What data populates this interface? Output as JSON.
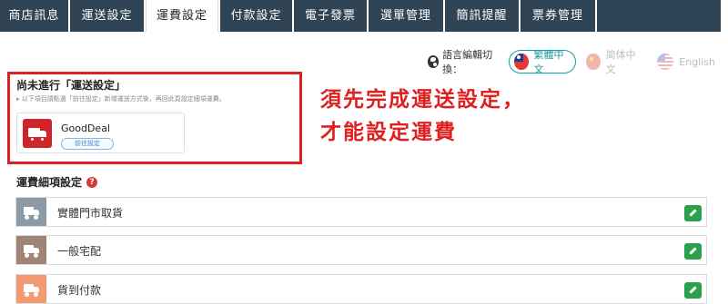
{
  "tabs": [
    {
      "label": "商店訊息",
      "active": false
    },
    {
      "label": "運送設定",
      "active": false
    },
    {
      "label": "運費設定",
      "active": true
    },
    {
      "label": "付款設定",
      "active": false
    },
    {
      "label": "電子發票",
      "active": false
    },
    {
      "label": "選單管理",
      "active": false
    },
    {
      "label": "簡訊提醒",
      "active": false
    },
    {
      "label": "票券管理",
      "active": false
    }
  ],
  "language": {
    "label": "語言編輯切換：",
    "options": [
      {
        "label": "繁體中文",
        "icon": "taiwan-flag-icon",
        "active": true
      },
      {
        "label": "简体中文",
        "icon": "china-flag-icon",
        "active": false
      },
      {
        "label": "English",
        "icon": "us-flag-icon",
        "active": false
      }
    ]
  },
  "notice": {
    "title": "尚未進行「運送設定」",
    "description": "▸ 以下項目請點選「前往設定」新增運送方式後，再回此頁設定細項運費。",
    "provider": {
      "name": "GoodDeal",
      "button": "前往設定",
      "icon": "delivery-truck-icon"
    }
  },
  "annotation": {
    "line1": "須先完成運送設定，",
    "line2": "才能設定運費"
  },
  "section": {
    "title": "運費細項設定",
    "help_icon": "question-circle-icon",
    "rows": [
      {
        "label": "實體門市取貨",
        "color": "#8a9aa6",
        "icon": "delivery-truck-icon"
      },
      {
        "label": "一般宅配",
        "color": "#a08478",
        "icon": "delivery-truck-icon"
      },
      {
        "label": "貨到付款",
        "color": "#f39a73",
        "icon": "delivery-truck-icon"
      }
    ]
  },
  "colors": {
    "tab_bg": "#2f4454",
    "highlight_red": "#e02020",
    "edit_green": "#2aa14a",
    "active_lang": "#0fa3a3"
  }
}
